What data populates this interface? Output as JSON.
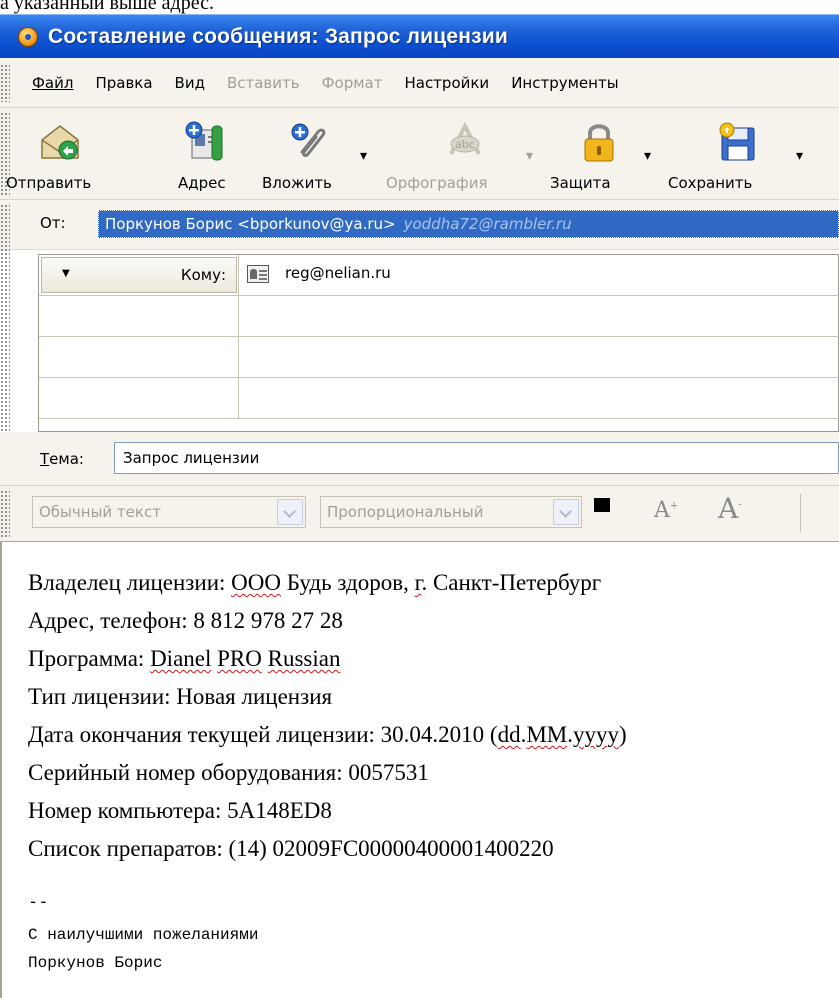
{
  "top_caption": "а указанный выше адрес.",
  "window": {
    "title": "Составление сообщения: Запрос лицензии"
  },
  "menu": {
    "file": "Файл",
    "edit": "Правка",
    "view": "Вид",
    "insert": "Вставить",
    "format": "Формат",
    "options": "Настройки",
    "tools": "Инструменты"
  },
  "toolbar": {
    "send": "Отправить",
    "address": "Адрес",
    "attach": "Вложить",
    "spelling": "Орфография",
    "security": "Защита",
    "save": "Сохранить"
  },
  "from": {
    "label": "От:",
    "value": "Поркунов Борис <bporkunov@ya.ru>",
    "alt_account": "yoddha72@rambler.ru"
  },
  "recipients": {
    "type_label": "Кому:",
    "address": "reg@nelian.ru"
  },
  "subject": {
    "label": "Тема:",
    "value": "Запрос лицензии"
  },
  "format_bar": {
    "paragraph_format": "Обычный текст",
    "font": "Пропорциональный"
  },
  "body": {
    "line1_prefix": "Владелец лицензии: ",
    "line1_ooo": "ООО",
    "line1_mid": " Будь здоров, ",
    "line1_g": "г",
    "line1_end": ". Санкт-Петербург",
    "line2": "Адрес, телефон: 8 812 978 27 28",
    "line3_prefix": "Программа: ",
    "line3_w1": "Dianel",
    "line3_w2": "PRO",
    "line3_w3": "Russian",
    "line4": "Тип лицензии: Новая лицензия",
    "line5_prefix": "Дата окончания текущей лицензии: 30.04.2010 (",
    "line5_dd": "dd",
    "line5_dot": ".",
    "line5_mm": "MM",
    "line5_dot2": ".",
    "line5_yyyy": "yyyy",
    "line5_end": ")",
    "line6": "Серийный номер оборудования: 0057531",
    "line7": "Номер компьютера: 5A148ED8",
    "line8": "Список препаратов: (14) 02009FC00000400001400220",
    "sig_dash": "--",
    "sig_line1": "С наилучшими пожеланиями",
    "sig_line2": "Поркунов Борис"
  },
  "icons": {
    "send": "send-envelope-icon",
    "address": "address-book-icon",
    "attach": "paperclip-icon",
    "spelling": "spellcheck-icon",
    "security": "padlock-icon",
    "save": "floppy-disk-icon"
  }
}
